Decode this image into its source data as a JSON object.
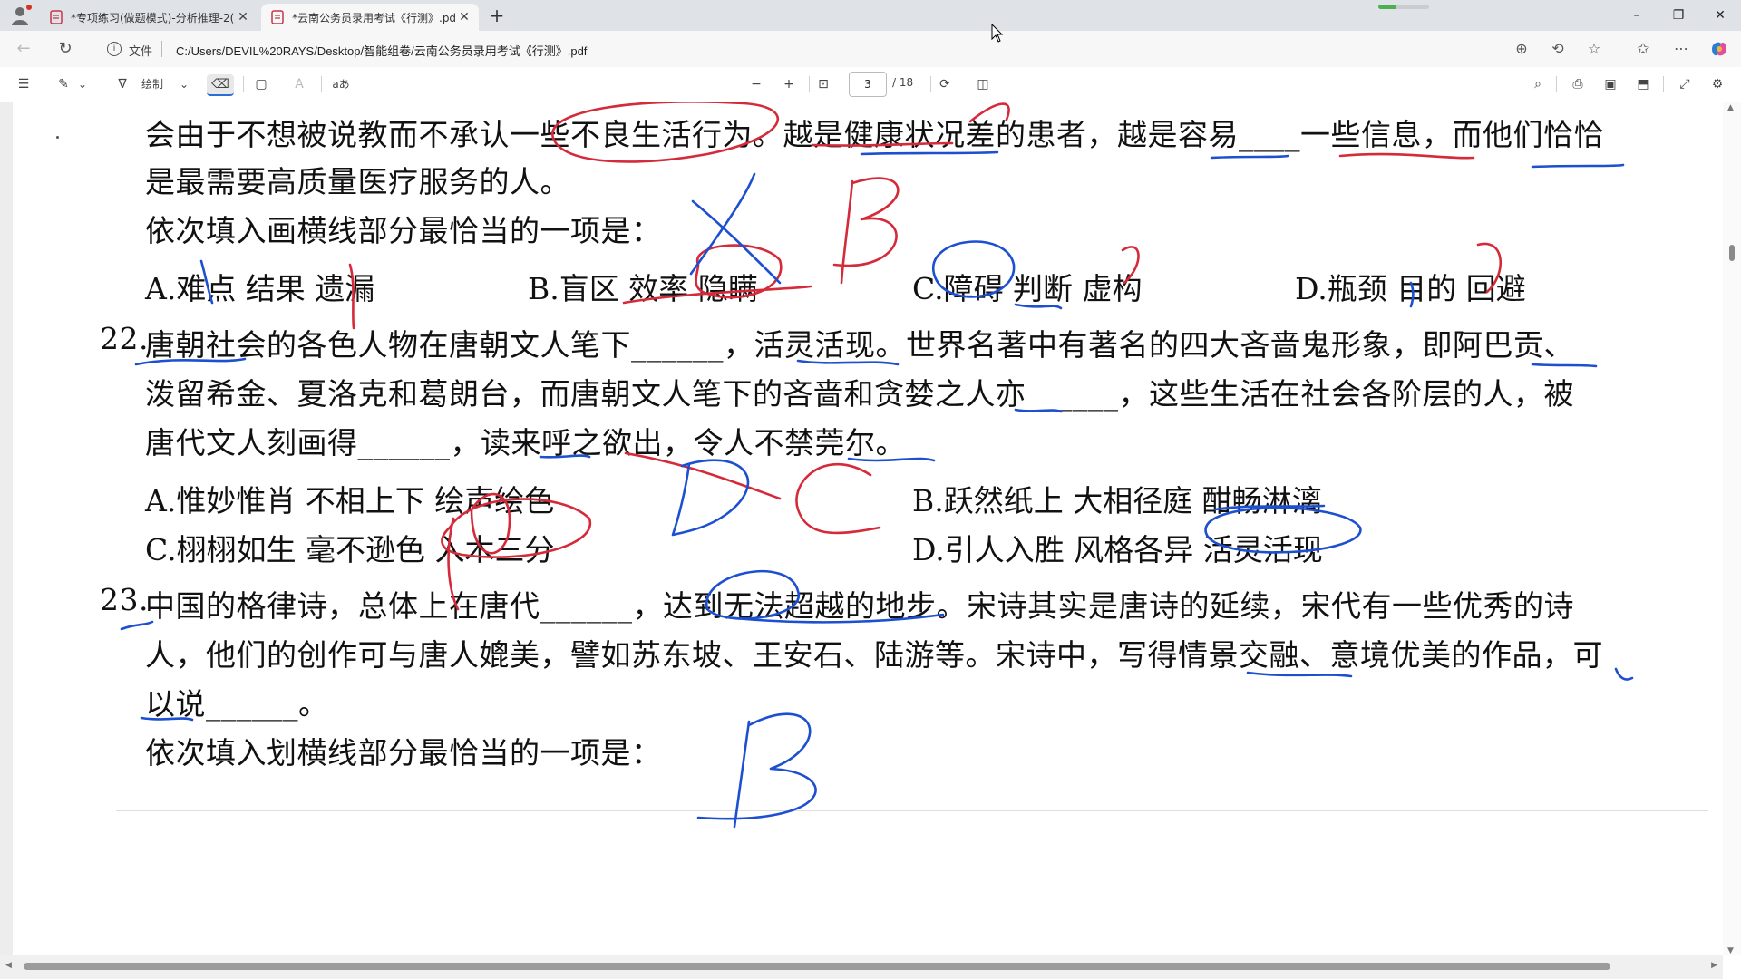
{
  "browser": {
    "tabs": [
      {
        "title": "*专项练习(做题模式)-分析推理-2(",
        "active": false
      },
      {
        "title": "*云南公务员录用考试《行测》.pdf",
        "active": true
      }
    ],
    "new_tab": "+",
    "url_prefix": "文件",
    "url": "C:/Users/DEVIL%20RAYS/Desktop/智能组卷/云南公务员录用考试《行测》.pdf",
    "window": {
      "minimize": "–",
      "restore": "❐",
      "close": "✕"
    }
  },
  "pdf_toolbar": {
    "draw_label": "绘制",
    "read_aloud": "aあ",
    "zoom_out": "−",
    "zoom_in": "+",
    "page_current": "3",
    "page_total": "/ 18"
  },
  "document": {
    "q21_tail": [
      "会由于不想被说教而不承认一些不良生活行为。越是健康状况差的患者，越是容易____一些信息，而他们恰恰",
      "是最需要高质量医疗服务的人。",
      "依次填入画横线部分最恰当的一项是："
    ],
    "q21_options": [
      "A.难点 结果 遗漏",
      "B.盲区 效率 隐瞒",
      "C.障碍 判断 虚构",
      "D.瓶颈 目的 回避"
    ],
    "q22": {
      "number": "22.",
      "lines": [
        "唐朝社会的各色人物在唐朝文人笔下______，活灵活现。世界名著中有著名的四大吝啬鬼形象，即阿巴贡、",
        "泼留希金、夏洛克和葛朗台，而唐朝文人笔下的吝啬和贪婪之人亦______，这些生活在社会各阶层的人，被",
        "唐代文人刻画得______，读来呼之欲出，令人不禁莞尔。"
      ],
      "options": [
        "A.惟妙惟肖 不相上下 绘声绘色",
        "B.跃然纸上 大相径庭 酣畅淋漓",
        "C.栩栩如生 毫不逊色 入木三分",
        "D.引人入胜 风格各异 活灵活现"
      ]
    },
    "q23": {
      "number": "23.",
      "lines": [
        "中国的格律诗，总体上在唐代______，达到无法超越的地步。宋诗其实是唐诗的延续，宋代有一些优秀的诗",
        "人，他们的创作可与唐人媲美，譬如苏东坡、王安石、陆游等。宋诗中，写得情景交融、意境优美的作品，可",
        "以说______。",
        "依次填入划横线部分最恰当的一项是："
      ]
    },
    "annotations": {
      "q21": "C B",
      "q22": "D C",
      "q23": "B",
      "colors": {
        "red": "#d42a3a",
        "blue": "#1d4fd1"
      }
    }
  }
}
